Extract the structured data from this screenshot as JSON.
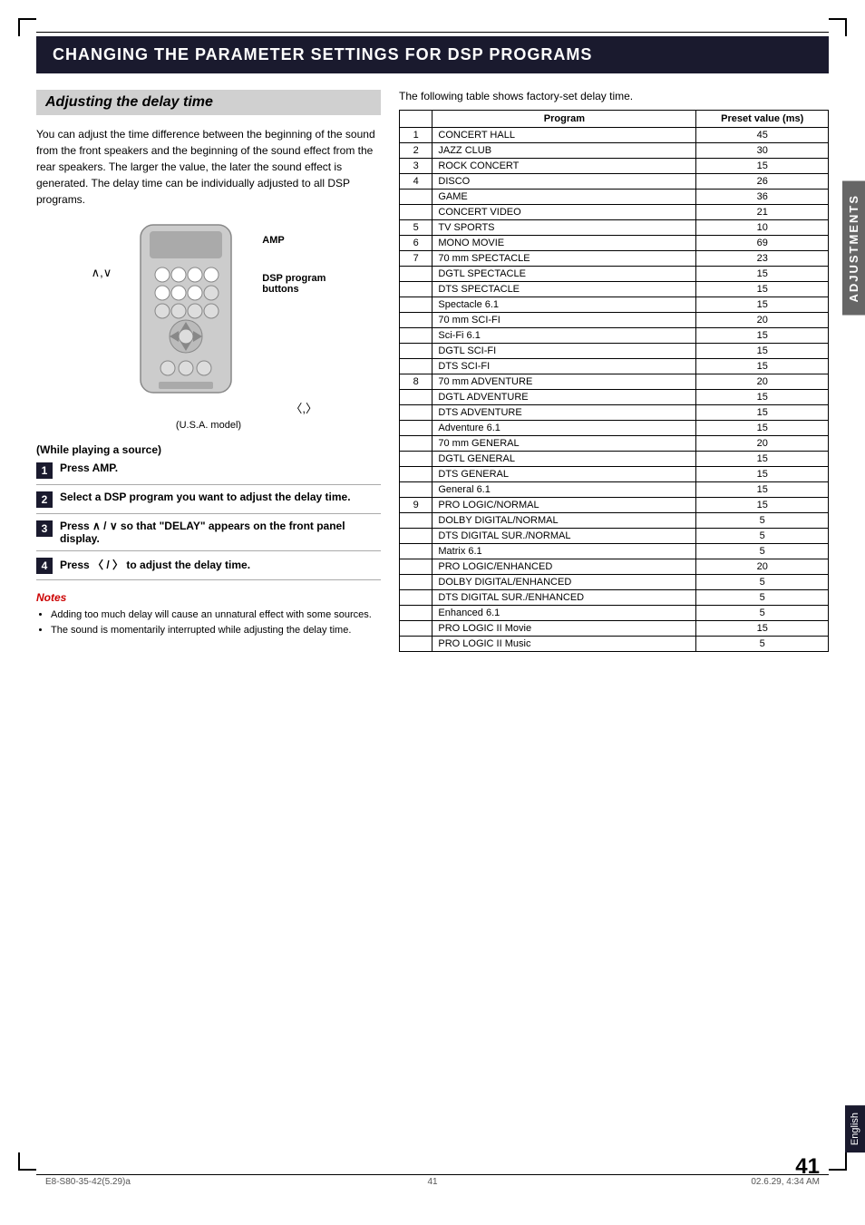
{
  "page": {
    "title": "CHANGING THE PARAMETER SETTINGS FOR DSP PROGRAMS",
    "footer_left": "E8-S80-35-42(5.29)a",
    "footer_center": "41",
    "footer_right": "02.6.29, 4:34 AM",
    "page_number": "41",
    "side_tab": "ADJUSTMENTS",
    "english_tab": "English"
  },
  "left": {
    "section_title": "Adjusting the delay time",
    "body_text": "You can adjust the time difference between the beginning of the sound from the front speakers and the beginning of the sound effect from the rear speakers. The larger the value, the later the sound effect is generated. The delay time can be individually adjusted to all DSP programs.",
    "diagram_caption": "(U.S.A. model)",
    "playing_source": "(While playing a source)",
    "labels": {
      "amp": "AMP",
      "dsp": "DSP program",
      "dsp2": "buttons"
    },
    "left_arrows": "∧,∨",
    "right_arrows": "〈,〉",
    "steps": [
      {
        "num": "1",
        "text": "Press AMP."
      },
      {
        "num": "2",
        "text": "Select a DSP program you want to adjust the delay time."
      },
      {
        "num": "3",
        "text": "Press ∧ / ∨ so that \"DELAY\" appears on the front panel display."
      },
      {
        "num": "4",
        "text": "Press 〈 / 〉 to adjust the delay time."
      }
    ],
    "notes_title": "Notes",
    "notes": [
      "Adding too much delay will cause an unnatural effect with some sources.",
      "The sound is momentarily interrupted while adjusting the delay time."
    ]
  },
  "right": {
    "table_caption": "The following table shows factory-set delay time.",
    "col_program": "Program",
    "col_preset": "Preset value (ms)",
    "rows": [
      {
        "num": "1",
        "program": "CONCERT HALL",
        "preset": "45"
      },
      {
        "num": "2",
        "program": "JAZZ CLUB",
        "preset": "30"
      },
      {
        "num": "3",
        "program": "ROCK CONCERT",
        "preset": "15"
      },
      {
        "num": "4",
        "program": "DISCO",
        "preset": "26"
      },
      {
        "num": "",
        "program": "GAME",
        "preset": "36"
      },
      {
        "num": "",
        "program": "CONCERT VIDEO",
        "preset": "21"
      },
      {
        "num": "5",
        "program": "TV SPORTS",
        "preset": "10"
      },
      {
        "num": "6",
        "program": "MONO MOVIE",
        "preset": "69"
      },
      {
        "num": "7",
        "program": "70 mm SPECTACLE",
        "preset": "23"
      },
      {
        "num": "",
        "program": "DGTL SPECTACLE",
        "preset": "15"
      },
      {
        "num": "",
        "program": "DTS SPECTACLE",
        "preset": "15"
      },
      {
        "num": "",
        "program": "Spectacle 6.1",
        "preset": "15"
      },
      {
        "num": "",
        "program": "70 mm SCI-FI",
        "preset": "20"
      },
      {
        "num": "",
        "program": "Sci-Fi 6.1",
        "preset": "15"
      },
      {
        "num": "",
        "program": "DGTL SCI-FI",
        "preset": "15"
      },
      {
        "num": "",
        "program": "DTS SCI-FI",
        "preset": "15"
      },
      {
        "num": "8",
        "program": "70 mm ADVENTURE",
        "preset": "20"
      },
      {
        "num": "",
        "program": "DGTL ADVENTURE",
        "preset": "15"
      },
      {
        "num": "",
        "program": "DTS ADVENTURE",
        "preset": "15"
      },
      {
        "num": "",
        "program": "Adventure 6.1",
        "preset": "15"
      },
      {
        "num": "",
        "program": "70 mm GENERAL",
        "preset": "20"
      },
      {
        "num": "",
        "program": "DGTL GENERAL",
        "preset": "15"
      },
      {
        "num": "",
        "program": "DTS GENERAL",
        "preset": "15"
      },
      {
        "num": "",
        "program": "General 6.1",
        "preset": "15"
      },
      {
        "num": "9",
        "program": "PRO LOGIC/NORMAL",
        "preset": "15"
      },
      {
        "num": "",
        "program": "DOLBY DIGITAL/NORMAL",
        "preset": "5"
      },
      {
        "num": "",
        "program": "DTS DIGITAL SUR./NORMAL",
        "preset": "5"
      },
      {
        "num": "",
        "program": "Matrix 6.1",
        "preset": "5"
      },
      {
        "num": "",
        "program": "PRO LOGIC/ENHANCED",
        "preset": "20"
      },
      {
        "num": "",
        "program": "DOLBY DIGITAL/ENHANCED",
        "preset": "5"
      },
      {
        "num": "",
        "program": "DTS DIGITAL SUR./ENHANCED",
        "preset": "5"
      },
      {
        "num": "",
        "program": "Enhanced 6.1",
        "preset": "5"
      },
      {
        "num": "",
        "program": "PRO LOGIC II Movie",
        "preset": "15"
      },
      {
        "num": "",
        "program": "PRO LOGIC II Music",
        "preset": "5"
      }
    ]
  }
}
